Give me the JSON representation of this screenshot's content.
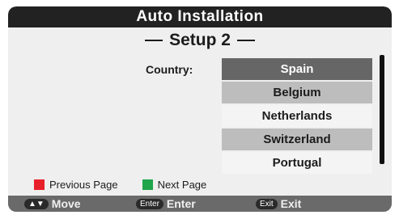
{
  "title": "Auto Installation",
  "subtitle": "Setup 2",
  "country_label": "Country:",
  "countries": [
    {
      "name": "Spain",
      "state": "selected"
    },
    {
      "name": "Belgium",
      "state": "alt"
    },
    {
      "name": "Netherlands",
      "state": "normal"
    },
    {
      "name": "Switzerland",
      "state": "alt"
    },
    {
      "name": "Portugal",
      "state": "normal"
    }
  ],
  "color_keys": {
    "previous_page": {
      "label": "Previous Page",
      "color": "#e8202a"
    },
    "next_page": {
      "label": "Next Page",
      "color": "#1fa54a"
    }
  },
  "hints": {
    "move": {
      "key": "▲▼",
      "label": "Move"
    },
    "enter": {
      "key": "Enter",
      "label": "Enter"
    },
    "exit": {
      "key": "Exit",
      "label": "Exit"
    }
  }
}
